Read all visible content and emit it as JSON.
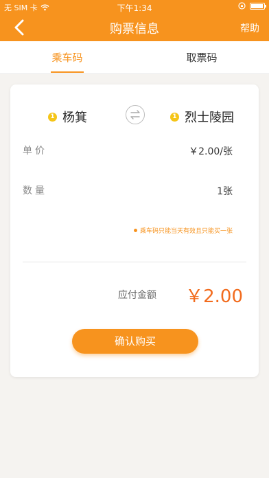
{
  "status_bar": {
    "carrier": "无 SIM 卡",
    "time": "下午1:34"
  },
  "nav": {
    "title": "购票信息",
    "help_label": "帮助"
  },
  "tabs": [
    {
      "label": "乘车码",
      "active": true
    },
    {
      "label": "取票码",
      "active": false
    }
  ],
  "trip": {
    "from": {
      "badge": "1",
      "name": "杨箕"
    },
    "to": {
      "badge": "1",
      "name": "烈士陵园"
    }
  },
  "details": {
    "unit_price_label": "单价",
    "unit_price_value": "￥2.00/张",
    "quantity_label": "数量",
    "quantity_value": "1张",
    "note": "乘车码只能当天有效且只能买一张"
  },
  "total": {
    "label": "应付金额",
    "value": "￥2.00"
  },
  "actions": {
    "confirm_label": "确认购买"
  },
  "colors": {
    "accent": "#f7931e",
    "price": "#f26b1d",
    "line_badge": "#f5c518"
  }
}
